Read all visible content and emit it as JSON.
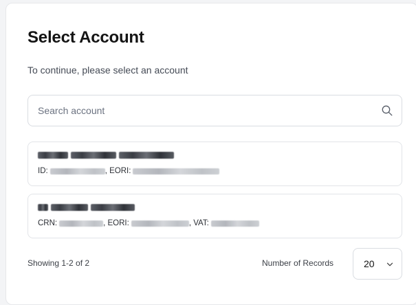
{
  "page": {
    "title": "Select Account",
    "subtitle": "To continue, please select an account"
  },
  "search": {
    "placeholder": "Search account",
    "value": "",
    "icon": "search-icon"
  },
  "accounts": [
    {
      "id_label": "ID:",
      "eori_label": ", EORI:"
    },
    {
      "crn_label": "CRN:",
      "eori_label": ", EORI:",
      "vat_label": ", VAT:"
    }
  ],
  "footer": {
    "showing": "Showing 1-2 of 2",
    "records_label": "Number of Records",
    "records_value": "20",
    "records_icon": "chevron-down-icon"
  },
  "colors": {
    "background": "#f3f4f6",
    "card": "#ffffff",
    "border": "#e2e4e8",
    "text": "#111111",
    "muted": "#444a55"
  }
}
